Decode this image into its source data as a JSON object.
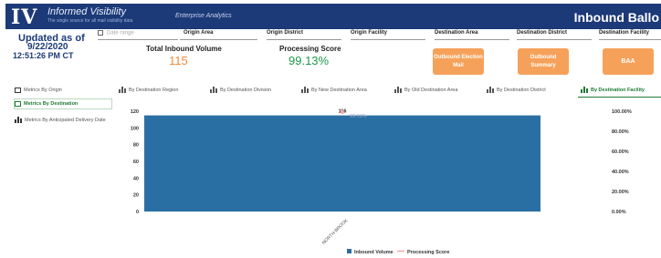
{
  "header": {
    "logo": "IV",
    "brand_title": "Informed Visibility",
    "brand_subtitle": "The single source for all mail visibility data",
    "nav_link": "Enterprise Analytics",
    "page_title": "Inbound Ballo"
  },
  "update": {
    "label": "Updated as of",
    "date": "9/22/2020",
    "time": "12:51:26 PM CT"
  },
  "filters": {
    "date_range": "Date range",
    "items": [
      "Origin Area",
      "Origin District",
      "Origin Facility",
      "Destination Area",
      "Destination District",
      "Destination Facility"
    ]
  },
  "kpis": {
    "volume_label": "Total Inbound Volume",
    "volume_value": "115",
    "score_label": "Processing Score",
    "score_value": "99.13%"
  },
  "actions": {
    "outbound_election_mail": "Outbound Election Mail",
    "outbound_summary": "Outbound Summary",
    "baa": "BAA"
  },
  "left_panel": {
    "items": [
      "Metrics By Origin",
      "Metrics By Destination",
      "Metrics By Anticipated Delivery Date"
    ]
  },
  "chart_tabs": [
    "By Destination Region",
    "By Destination Division",
    "By New Destination Area",
    "By Old Destination Area",
    "By Destination District",
    "By Destination Facility"
  ],
  "colors": {
    "header": "#1c3a78",
    "bar": "#2a6fa3",
    "accent_orange": "#f6a15a",
    "active_green": "#1f7a33",
    "score_green": "#1f9a4c",
    "volume_orange": "#f08a3c",
    "score_line": "#f3a6a6"
  },
  "icons": {
    "calendar": "calendar-icon",
    "list": "list-icon",
    "bar_chart": "bar-chart-icon"
  },
  "chart_data": {
    "type": "bar",
    "categories": [
      "NORTH BROOK"
    ],
    "series": [
      {
        "name": "Inbound Volume",
        "values": [
          115
        ],
        "axis": "left",
        "color": "#2a6fa3"
      },
      {
        "name": "Processing Score",
        "values": [
          99.13
        ],
        "axis": "right",
        "color": "#f3a6a6"
      }
    ],
    "data_labels": [
      "116",
      "99.13%"
    ],
    "y_ticks": [
      "120",
      "100",
      "80",
      "60",
      "40",
      "20",
      "0"
    ],
    "y2_ticks": [
      "100.00%",
      "80.00%",
      "60.00%",
      "40.00%",
      "20.00%",
      "0.00%"
    ],
    "ylim": [
      0,
      120
    ],
    "y2lim": [
      0,
      100
    ],
    "legend_position": "bottom-center"
  }
}
